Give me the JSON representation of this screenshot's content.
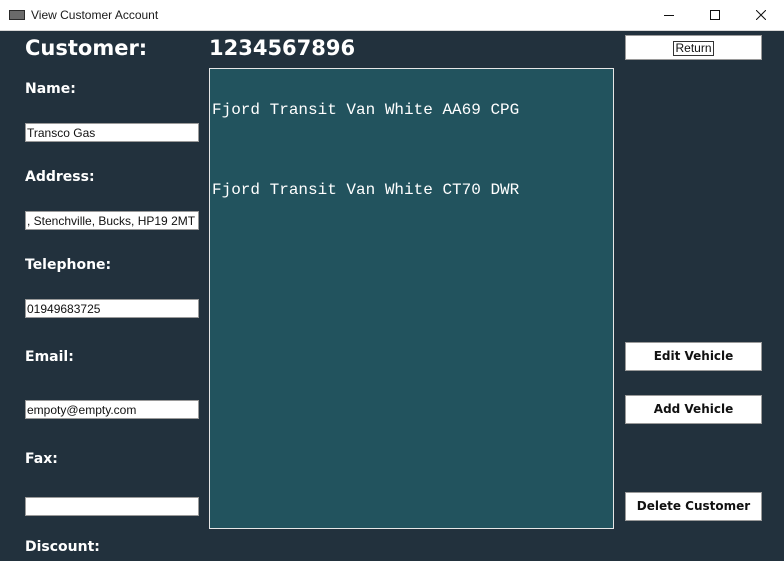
{
  "window": {
    "title": "View Customer Account"
  },
  "header": {
    "customer_label": "Customer:",
    "customer_number": "1234567896"
  },
  "form": {
    "name_label": "Name:",
    "name_value": "Transco Gas",
    "address_label": "Address:",
    "address_value": ", Stenchville, Bucks, HP19 2MT",
    "telephone_label": "Telephone:",
    "telephone_value": "01949683725",
    "email_label": "Email:",
    "email_value": "empoty@empty.com",
    "fax_label": "Fax:",
    "fax_value": "",
    "discount_label": "Discount:"
  },
  "vehicles": [
    "Fjord Transit Van White AA69 CPG",
    "Fjord Transit Van White CT70 DWR"
  ],
  "buttons": {
    "return": "Return",
    "edit_vehicle": "Edit Vehicle",
    "add_vehicle": "Add Vehicle",
    "delete_customer": "Delete Customer"
  },
  "colors": {
    "background": "#22313d",
    "list_background": "#22535e"
  }
}
